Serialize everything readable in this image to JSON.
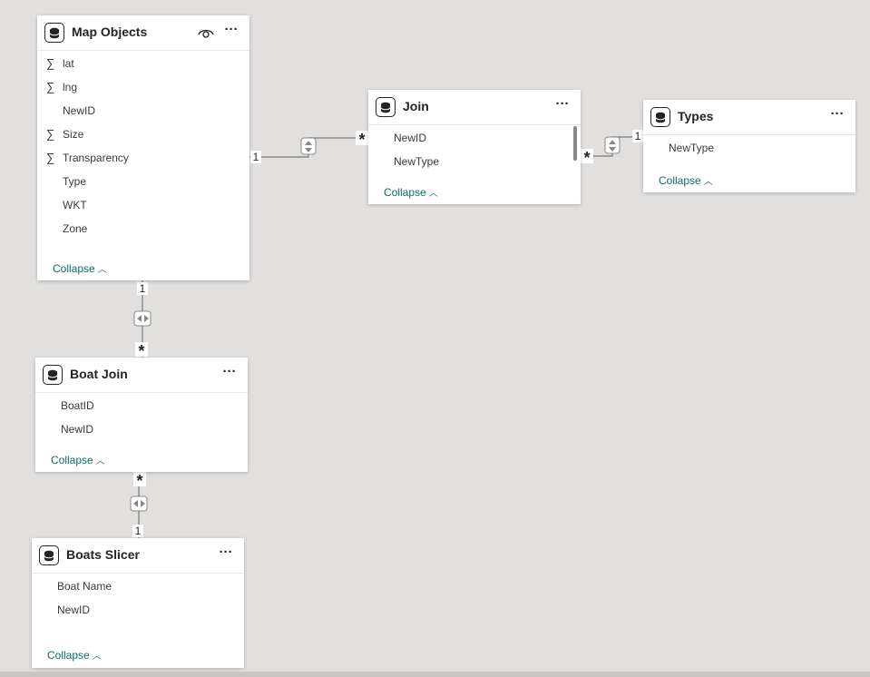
{
  "tables": [
    {
      "title": "Map Objects",
      "fields": [
        {
          "name": "lat",
          "icon": "sigma"
        },
        {
          "name": "lng",
          "icon": "sigma"
        },
        {
          "name": "NewID",
          "icon": ""
        },
        {
          "name": "Size",
          "icon": "sigma"
        },
        {
          "name": "Transparency",
          "icon": "sigma"
        },
        {
          "name": "Type",
          "icon": ""
        },
        {
          "name": "WKT",
          "icon": ""
        },
        {
          "name": "Zone",
          "icon": ""
        }
      ],
      "collapse_label": "Collapse",
      "more_label": "···"
    },
    {
      "title": "Join",
      "fields": [
        {
          "name": "NewID"
        },
        {
          "name": "NewType"
        }
      ],
      "collapse_label": "Collapse",
      "more_label": "···"
    },
    {
      "title": "Types",
      "fields": [
        {
          "name": "NewType"
        }
      ],
      "collapse_label": "Collapse",
      "more_label": "···"
    },
    {
      "title": "Boat Join",
      "fields": [
        {
          "name": "BoatID"
        },
        {
          "name": "NewID"
        }
      ],
      "collapse_label": "Collapse",
      "more_label": "···"
    },
    {
      "title": "Boats Slicer",
      "fields": [
        {
          "name": "Boat Name"
        },
        {
          "name": "NewID"
        }
      ],
      "collapse_label": "Collapse",
      "more_label": "···"
    }
  ],
  "relationships": [
    {
      "from": "Map Objects",
      "to": "Join",
      "from_cardinality": "1",
      "to_cardinality": "*"
    },
    {
      "from": "Join",
      "to": "Types",
      "from_cardinality": "*",
      "to_cardinality": "1"
    },
    {
      "from": "Map Objects",
      "to": "Boat Join",
      "from_cardinality": "1",
      "to_cardinality": "*"
    },
    {
      "from": "Boat Join",
      "to": "Boats Slicer",
      "from_cardinality": "*",
      "to_cardinality": "1"
    }
  ],
  "icons": {
    "table": "database-icon",
    "visibility": "eye-icon",
    "aggregate": "sigma-icon",
    "filter_direction": "filter-direction-icon"
  },
  "colors": {
    "canvas": "#e2e0de",
    "card": "#ffffff",
    "collapse_link": "#0f6e63",
    "connector": "#8a8886"
  }
}
